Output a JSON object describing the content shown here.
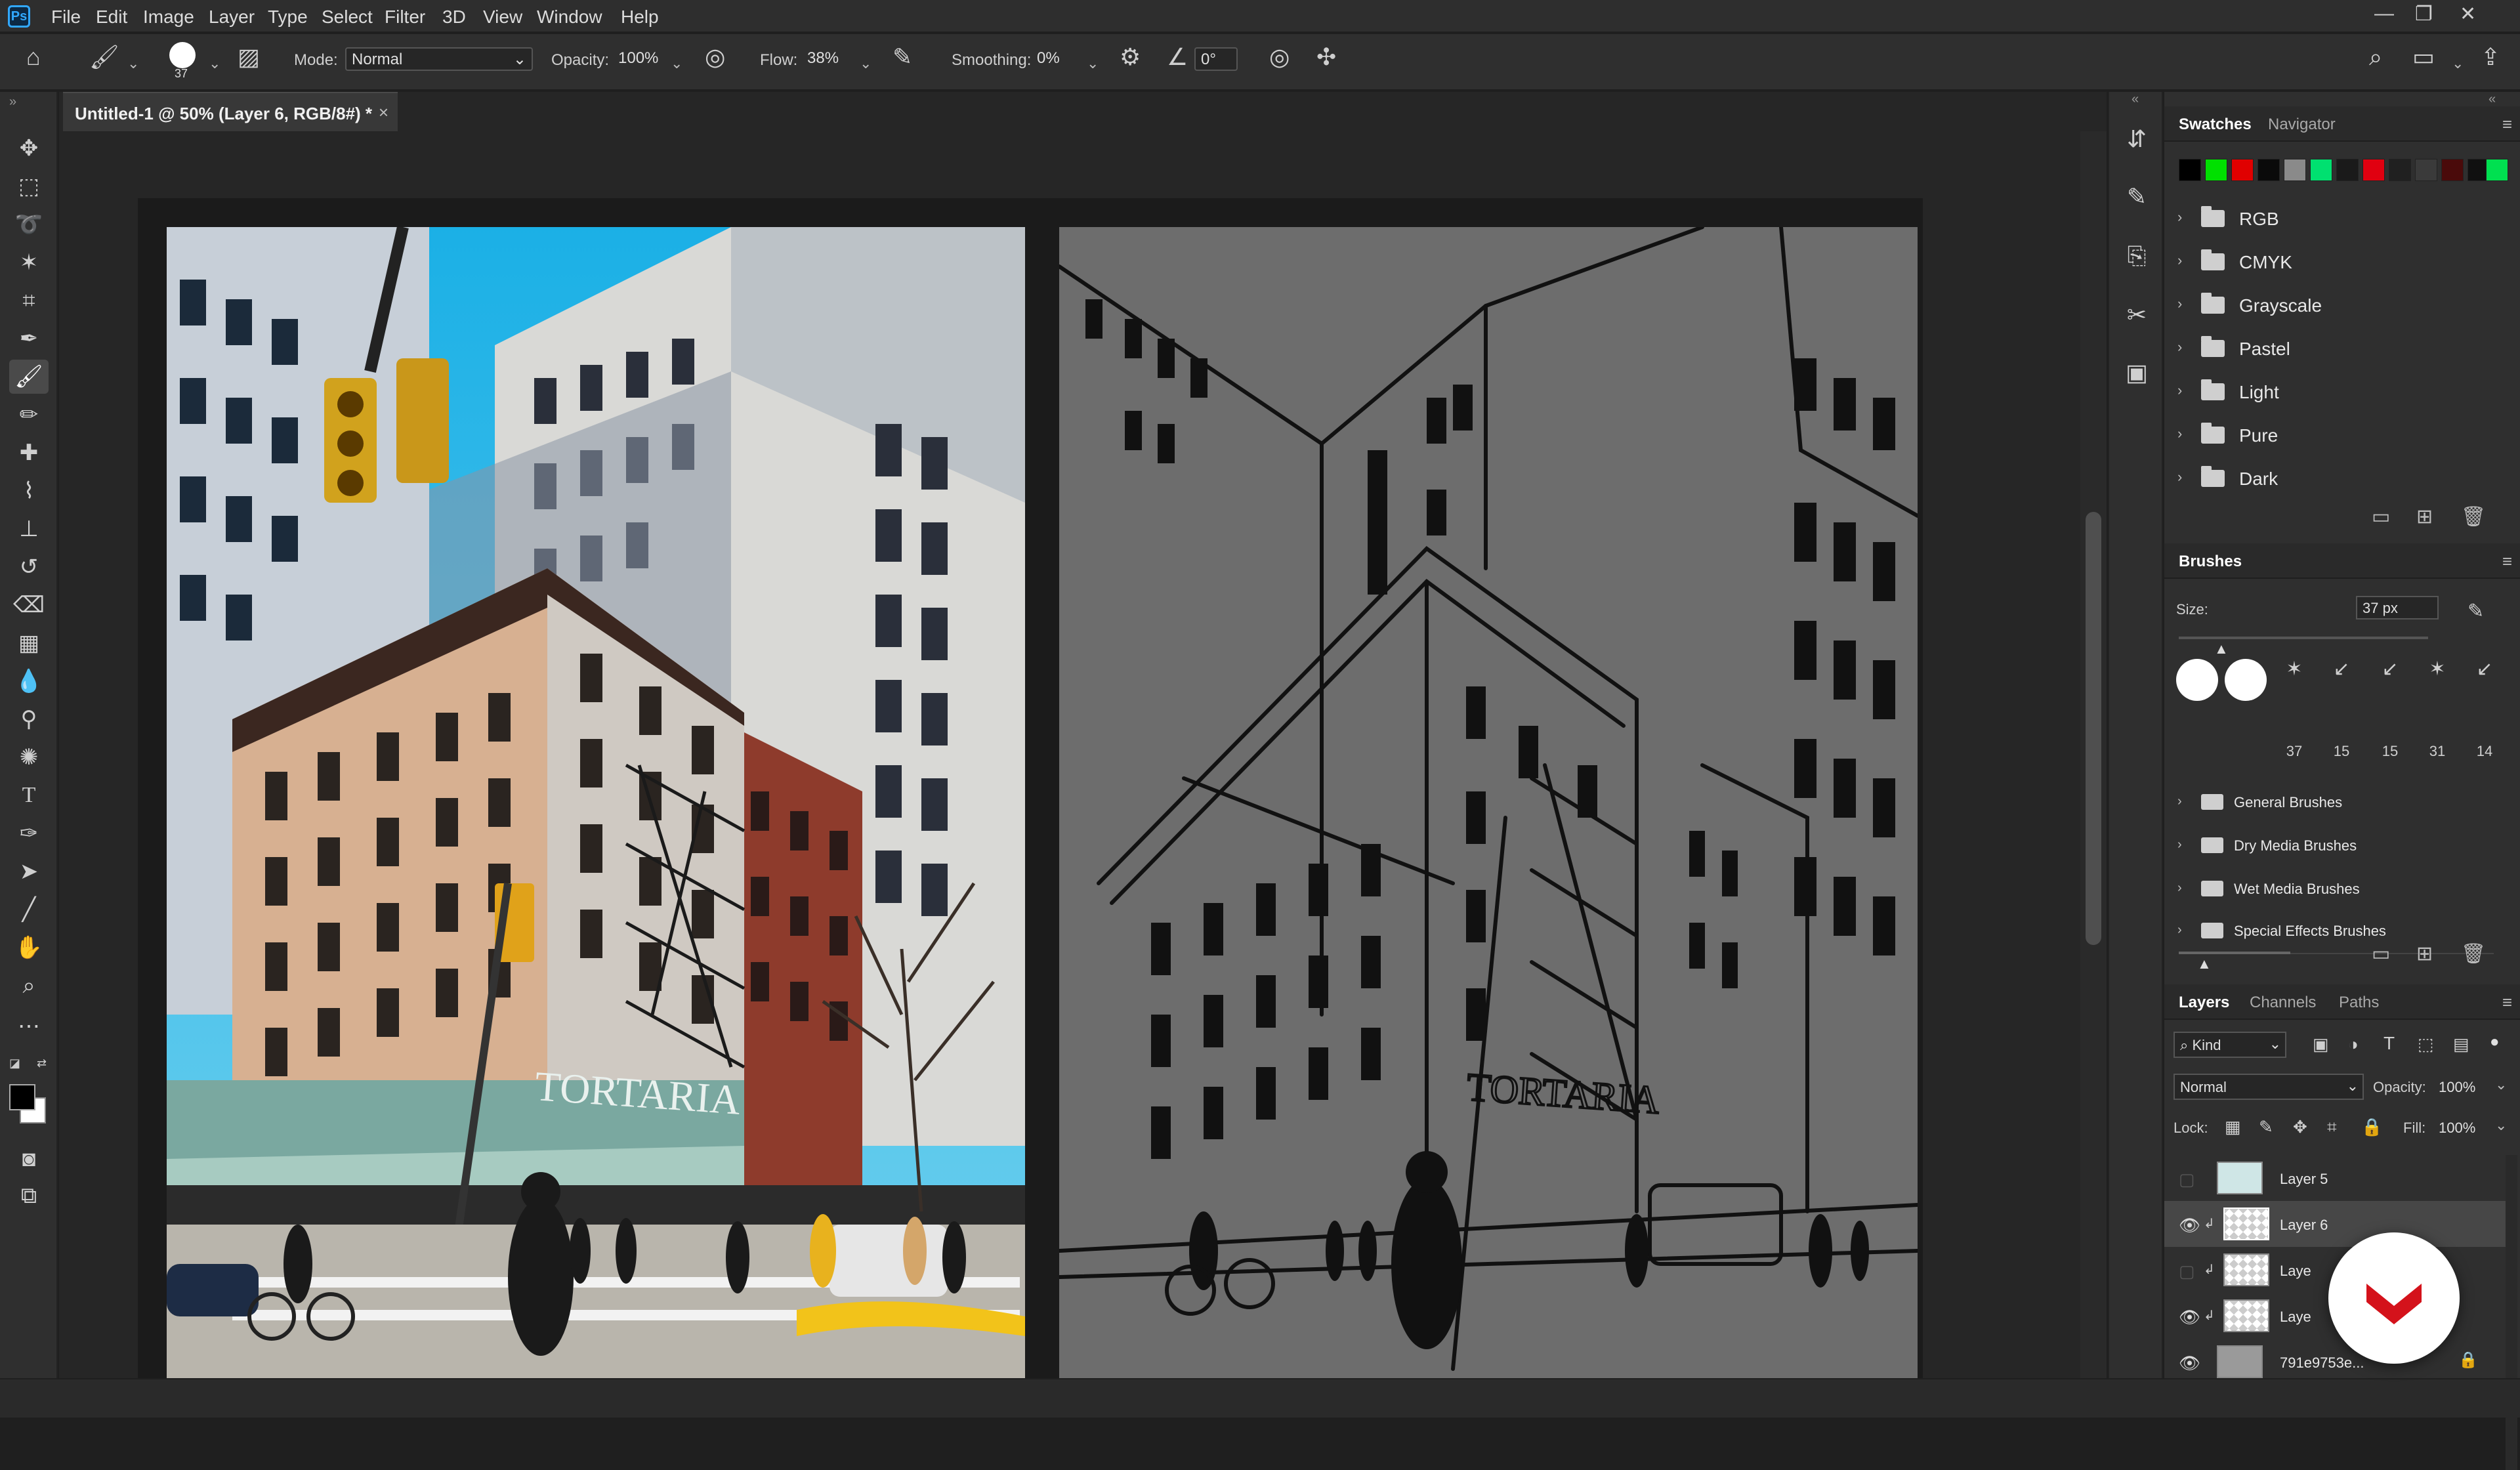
{
  "app": {
    "logo": "Ps"
  },
  "menu": [
    "File",
    "Edit",
    "Image",
    "Layer",
    "Type",
    "Select",
    "Filter",
    "3D",
    "View",
    "Window",
    "Help"
  ],
  "options": {
    "brush_size": "37",
    "mode_label": "Mode:",
    "mode_value": "Normal",
    "opacity_label": "Opacity:",
    "opacity_value": "100%",
    "flow_label": "Flow:",
    "flow_value": "38%",
    "smoothing_label": "Smoothing:",
    "smoothing_value": "0%",
    "angle_value": "0°"
  },
  "document": {
    "tab_title": "Untitled-1 @ 50% (Layer 6, RGB/8#) *",
    "close": "×"
  },
  "tools": [
    "move-tool",
    "marquee-tool",
    "lasso-tool",
    "magic-wand-tool",
    "crop-tool",
    "eyedropper-tool",
    "brush-tool",
    "pencil-tool",
    "healing-tool",
    "mixer-brush-tool",
    "stamp-tool",
    "history-brush-tool",
    "eraser-tool",
    "gradient-tool",
    "blur-tool",
    "dodge-tool",
    "sponge-tool",
    "type-tool",
    "pen-tool",
    "path-selection-tool",
    "line-tool",
    "hand-tool",
    "zoom-tool",
    "more-tools"
  ],
  "swatches": {
    "tabs": [
      "Swatches",
      "Navigator"
    ],
    "colors": [
      "#000000",
      "#00e000",
      "#e00000",
      "#0a0a0a",
      "#8a8a8a",
      "#00e070",
      "#1a1a1a",
      "#e00010",
      "#202020",
      "#3a3a3a",
      "#4a0a0a",
      "#101010",
      "#00e050"
    ],
    "groups": [
      "RGB",
      "CMYK",
      "Grayscale",
      "Pastel",
      "Light",
      "Pure",
      "Dark"
    ]
  },
  "brushes": {
    "title": "Brushes",
    "size_label": "Size:",
    "size_value": "37 px",
    "presets": [
      "37",
      "15",
      "15",
      "31",
      "14"
    ],
    "groups": [
      "General Brushes",
      "Dry Media Brushes",
      "Wet Media Brushes",
      "Special Effects Brushes"
    ]
  },
  "layers": {
    "tabs": [
      "Layers",
      "Channels",
      "Paths"
    ],
    "kind_label": "Kind",
    "blend_mode": "Normal",
    "opacity_label": "Opacity:",
    "opacity_value": "100%",
    "lock_label": "Lock:",
    "fill_label": "Fill:",
    "fill_value": "100%",
    "items": [
      {
        "name": "Layer 5",
        "visible": false,
        "selected": false
      },
      {
        "name": "Layer 6",
        "visible": true,
        "selected": true
      },
      {
        "name": "Laye",
        "visible": false,
        "selected": false
      },
      {
        "name": "Laye",
        "visible": true,
        "selected": false
      },
      {
        "name": "791e9753e...",
        "visible": true,
        "selected": false
      }
    ]
  },
  "photo_sign": "TORTARIA",
  "sketch_sign": "TORTARIA"
}
